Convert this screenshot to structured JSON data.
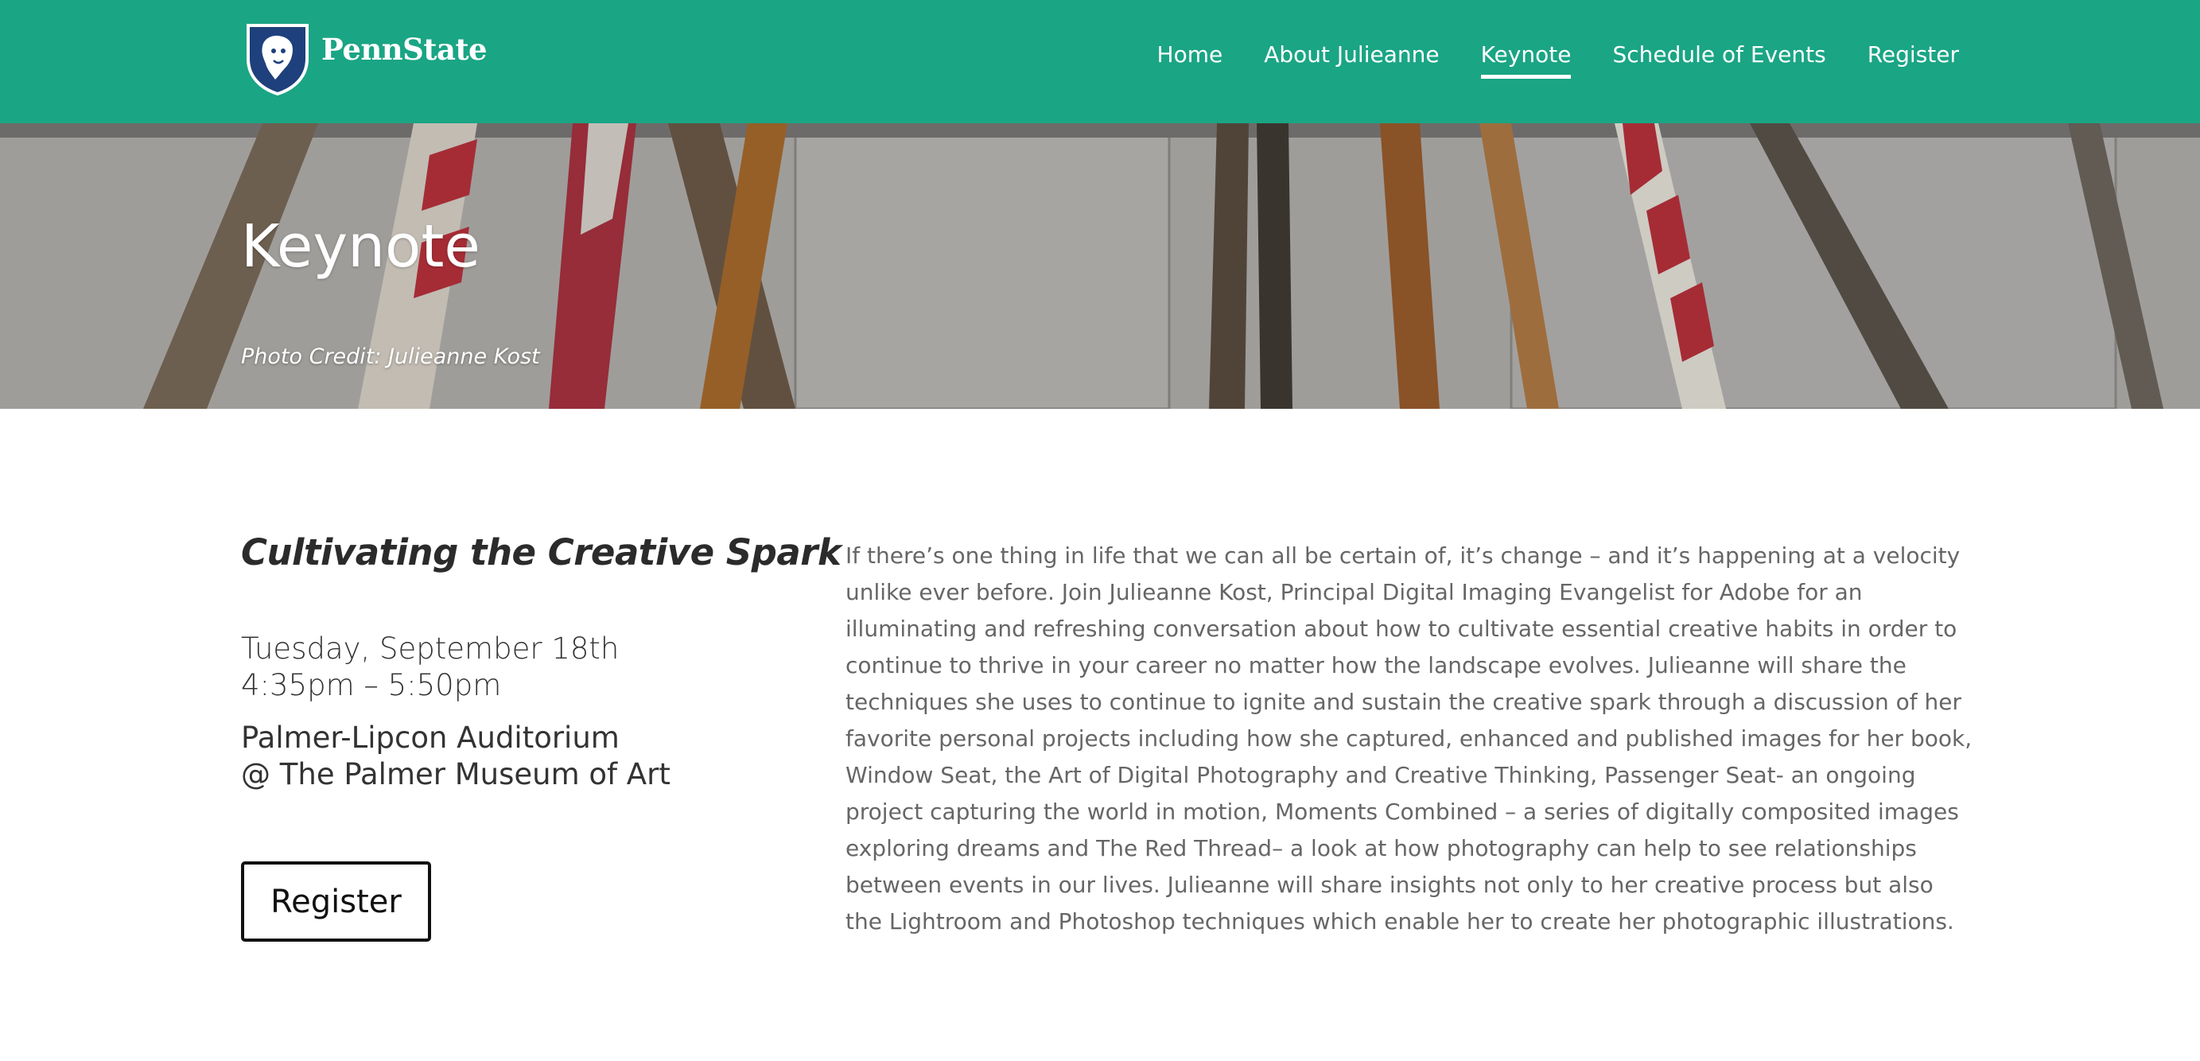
{
  "brand": {
    "name": "PennState",
    "colors": {
      "header": "#1aa584",
      "text": "#333333",
      "body_text": "#666666"
    }
  },
  "nav": {
    "items": [
      {
        "label": "Home"
      },
      {
        "label": "About Julieanne"
      },
      {
        "label": "Keynote",
        "active": true
      },
      {
        "label": "Schedule of Events"
      },
      {
        "label": "Register"
      }
    ]
  },
  "hero": {
    "title": "Keynote",
    "credit": "Photo Credit: Julieanne Kost"
  },
  "event": {
    "title": "Cultivating the Creative Spark",
    "date": "Tuesday, September 18th",
    "time": "4:35pm – 5:50pm",
    "venue": "Palmer-Lipcon Auditorium",
    "location": "@ The Palmer Museum of Art",
    "register_label": "Register"
  },
  "description": "If there’s one thing in life that we can all be certain of, it’s change – and it’s happening at a velocity unlike ever before.  Join Julieanne Kost, Principal Digital Imaging Evangelist for Adobe for an illuminating and refreshing conversation about how to cultivate essential creative habits in order to continue to thrive in your career no matter how the landscape evolves. Julieanne will share the techniques she uses to continue to ignite and sustain the creative spark through a discussion of her favorite personal projects including how she captured, enhanced and published images for her book, Window Seat, the Art of Digital Photography and Creative Thinking, Passenger Seat- an ongoing project capturing the world in motion, Moments Combined – a series of digitally composited images exploring dreams and The Red Thread– a look at how photography can help to see relationships between events in our lives. Julieanne will share insights not only to her creative process but also the Lightroom and Photoshop techniques which enable her to create her photographic illustrations."
}
